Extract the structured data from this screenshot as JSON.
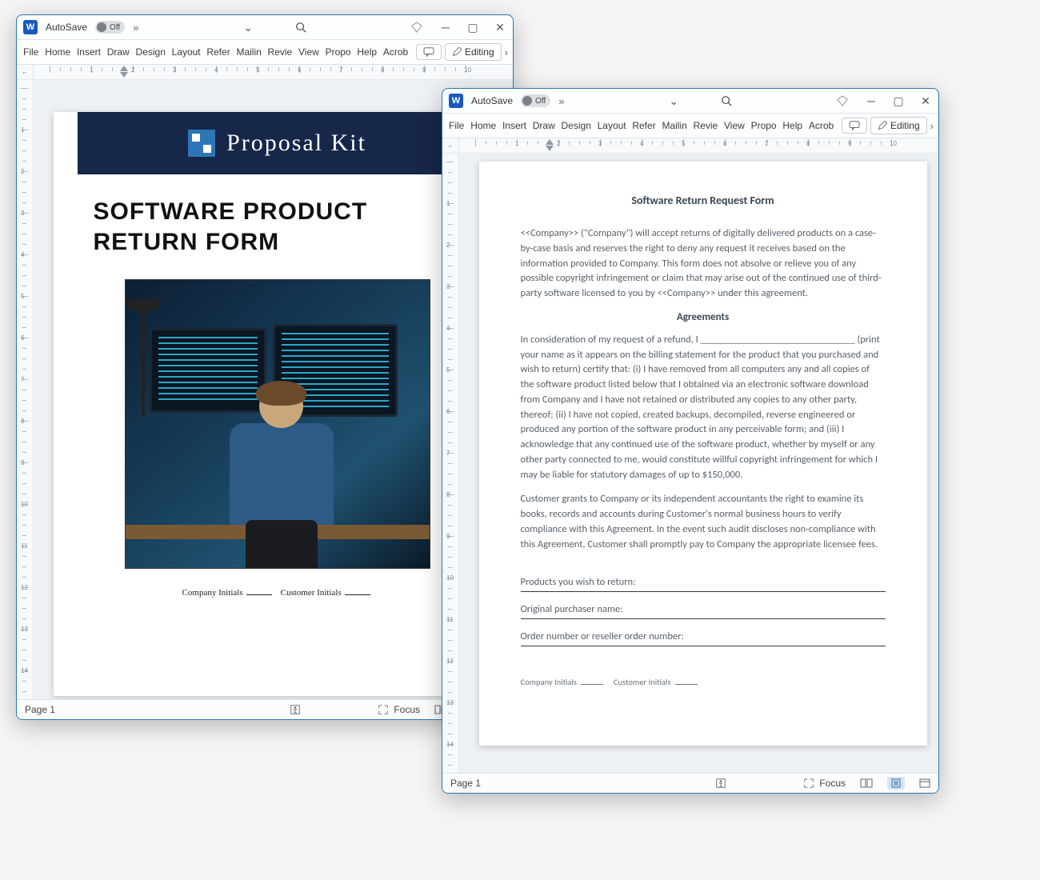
{
  "app": {
    "autosave_label": "AutoSave",
    "autosave_state": "Off",
    "editing_label": "Editing",
    "ribbon_tabs": [
      "File",
      "Home",
      "Insert",
      "Draw",
      "Design",
      "Layout",
      "Refer",
      "Mailin",
      "Revie",
      "View",
      "Propo",
      "Help",
      "Acrob"
    ],
    "focus_label": "Focus",
    "page_label": "Page 1"
  },
  "window1": {
    "banner_brand": "Proposal Kit",
    "doc_title_line1": "SOFTWARE PRODUCT",
    "doc_title_line2": "RETURN FORM",
    "initials_company": "Company Initials",
    "initials_customer": "Customer Initials"
  },
  "window2": {
    "title": "Software Return Request Form",
    "para1": "<<Company>> (\"Company\") will accept returns of digitally delivered products on a case-by-case basis and reserves the right to deny any request it receives based on the information provided to Company. This form does not absolve or relieve you of any possible copyright infringement or claim that may arise out of the continued use of third-party software licensed to you by <<Company>> under this agreement.",
    "agreements_heading": "Agreements",
    "para2": "In consideration of my request of a refund, I _______________________________ (print your name as it appears on the billing statement for the product that you purchased and wish to return) certify that: (i) I have removed from all computers any and all copies of the software product listed below that I obtained via an electronic software download from Company and I have not retained or distributed any copies to any other party, thereof; (ii) I have not copied, created backups, decompiled, reverse engineered or produced any portion of the software product in any perceivable form; and (iii) I acknowledge that any continued use of the software product, whether by myself or any other party connected to me, would constitute willful copyright infringement for which I may be liable for statutory damages of up to $150,000.",
    "para3": "Customer grants to Company or its independent accountants the right to examine its books, records and accounts during Customer's normal business hours to verify compliance with this Agreement. In the event such audit discloses non-compliance with this Agreement, Customer shall promptly pay to Company the appropriate licensee fees.",
    "field_products": "Products you wish to return:",
    "field_purchaser": "Original purchaser name:",
    "field_order": "Order number or reseller order number:",
    "foot_company": "Company Initials",
    "foot_customer": "Customer Initials"
  }
}
